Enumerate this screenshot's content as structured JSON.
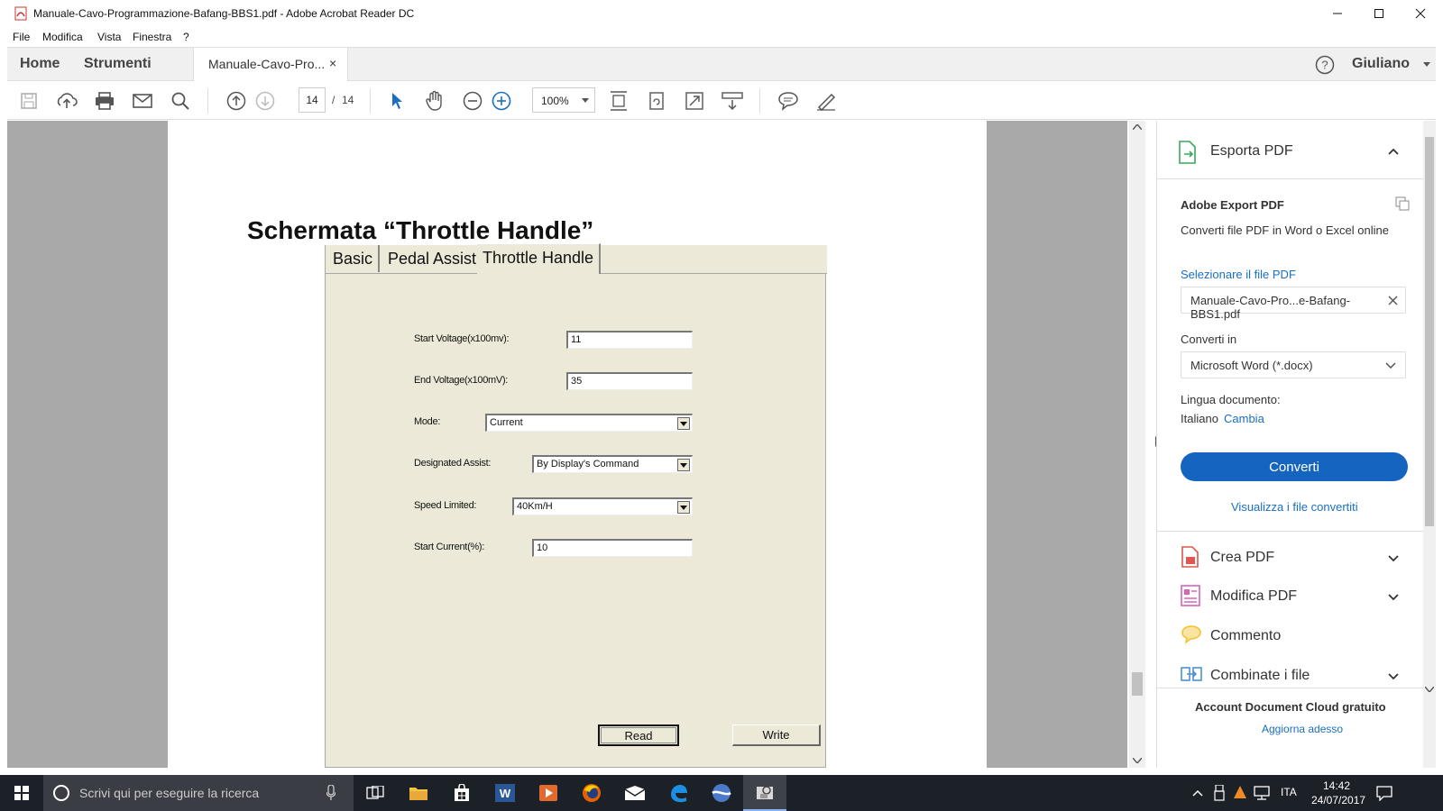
{
  "window": {
    "title": "Manuale-Cavo-Programmazione-Bafang-BBS1.pdf - Adobe Acrobat Reader DC"
  },
  "menu": [
    "File",
    "Modifica",
    "Vista",
    "Finestra",
    "?"
  ],
  "tabs": {
    "home": "Home",
    "tools": "Strumenti",
    "document": "Manuale-Cavo-Pro...",
    "close": "×",
    "user": "Giuliano"
  },
  "toolbar": {
    "page_current": "14",
    "page_separator": "/",
    "page_total": "14",
    "zoom": "100%"
  },
  "document": {
    "heading": "Schermata “Throttle Handle”",
    "dialog": {
      "tabs": [
        "Basic",
        "Pedal Assist",
        "Throttle Handle"
      ],
      "active_tab": "Throttle Handle",
      "fields": {
        "start_voltage_label": "Start Voltage(x100mv):",
        "start_voltage_value": "11",
        "end_voltage_label": "End Voltage(x100mV):",
        "end_voltage_value": "35",
        "mode_label": "Mode:",
        "mode_value": "Current",
        "designated_assist_label": "Designated Assist:",
        "designated_assist_value": "By Display's Command",
        "speed_limited_label": "Speed Limited:",
        "speed_limited_value": "40Km/H",
        "start_current_label": "Start Current(%):",
        "start_current_value": "10"
      },
      "read_button": "Read",
      "write_button": "Write"
    }
  },
  "right_pane": {
    "export_title": "Esporta PDF",
    "adobe_export_title": "Adobe Export PDF",
    "adobe_export_desc": "Converti file PDF in Word o Excel online",
    "select_file_label": "Selezionare il file PDF",
    "selected_file": "Manuale-Cavo-Pro...e-Bafang-BBS1.pdf",
    "convert_to_label": "Converti in",
    "convert_to_value": "Microsoft Word (*.docx)",
    "doc_language_label": "Lingua documento:",
    "doc_language_value": "Italiano",
    "change_link": "Cambia",
    "convert_button": "Converti",
    "view_converted_link": "Visualizza i file convertiti",
    "tools": [
      {
        "label": "Crea PDF",
        "icon": "create-pdf-icon",
        "color": "#e0574f"
      },
      {
        "label": "Modifica PDF",
        "icon": "edit-pdf-icon",
        "color": "#d963b5"
      },
      {
        "label": "Commento",
        "icon": "comment-icon",
        "color": "#f2c22e"
      },
      {
        "label": "Combinate i file",
        "icon": "combine-files-icon",
        "color": "#4a90d9"
      }
    ],
    "cloud_title": "Account Document Cloud gratuito",
    "cloud_link": "Aggiorna adesso"
  },
  "taskbar": {
    "search_placeholder": "Scrivi qui per eseguire la ricerca",
    "language": "ITA",
    "time": "14:42",
    "date": "24/07/2017"
  },
  "colors": {
    "accent_blue": "#1a6fc1",
    "convert_button": "#1565c0",
    "dialog_bg": "#ece9d8",
    "doc_bg": "#a9a9a9",
    "taskbar": "#1c2027"
  }
}
